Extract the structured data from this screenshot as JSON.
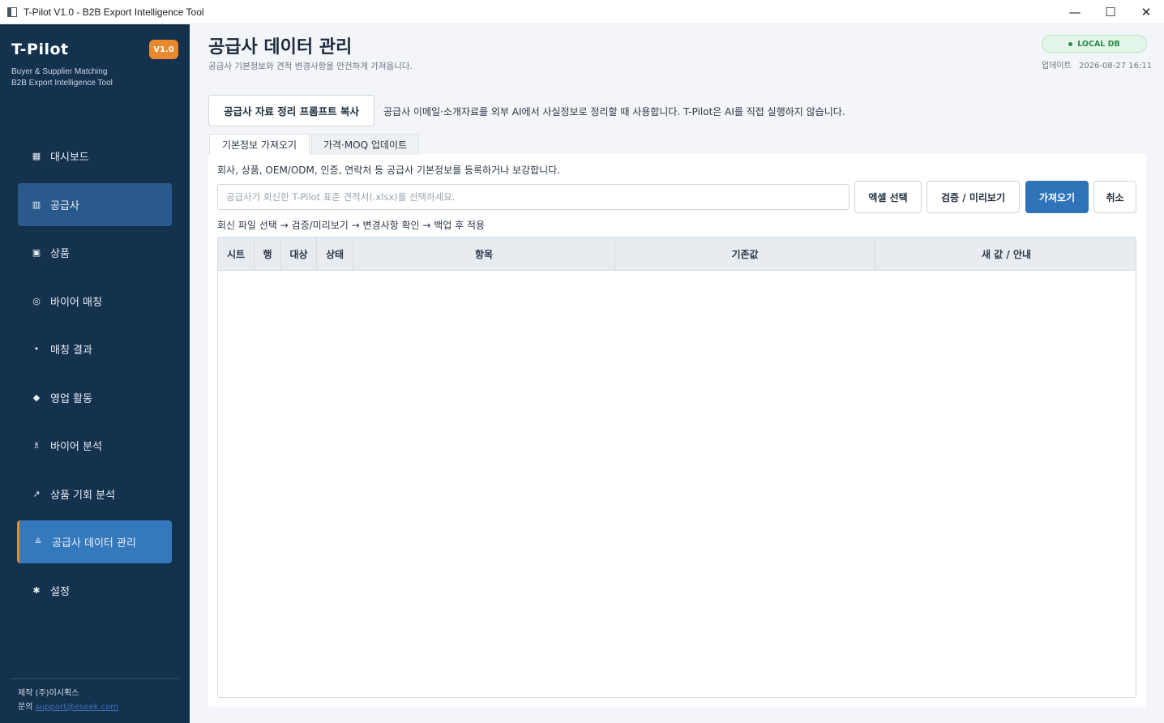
{
  "window": {
    "title": "T-Pilot V1.0 - B2B Export Intelligence Tool",
    "minimize": "—",
    "maximize": "☐",
    "close": "✕"
  },
  "sidebar": {
    "brand": "T-Pilot",
    "version": "V1.0",
    "tagline1": "Buyer & Supplier Matching",
    "tagline2": "B2B Export Intelligence Tool",
    "items": [
      {
        "label": "대시보드",
        "icon": "▦",
        "icon_name": "dashboard-icon"
      },
      {
        "label": "공급사",
        "icon": "▥",
        "icon_name": "supplier-icon"
      },
      {
        "label": "상품",
        "icon": "▣",
        "icon_name": "product-icon"
      },
      {
        "label": "바이어 매칭",
        "icon": "◎",
        "icon_name": "target-icon"
      },
      {
        "label": "매칭 결과",
        "icon": "•",
        "icon_name": "result-icon"
      },
      {
        "label": "영업 활동",
        "icon": "◆",
        "icon_name": "diamond-icon"
      },
      {
        "label": "바이어 분석",
        "icon": "♗",
        "icon_name": "analysis-icon"
      },
      {
        "label": "상품 기회 분석",
        "icon": "↗",
        "icon_name": "trend-icon"
      },
      {
        "label": "공급사 데이터 관리",
        "icon": "≗",
        "icon_name": "data-icon"
      },
      {
        "label": "설정",
        "icon": "✱",
        "icon_name": "gear-icon"
      }
    ],
    "footer_maker": "제작 (주)이시휙스",
    "footer_contact_label": "문의",
    "footer_contact_email": "support@eseek.com"
  },
  "header": {
    "title": "공급사 데이터 관리",
    "subtitle": "공급사 기본정보와 견적 변경사항을 안전하게 가져옵니다.",
    "db_badge": "LOCAL DB",
    "updated_label": "업데이트",
    "updated_value": "2026-08-27 16:11"
  },
  "prompt": {
    "button_label": "공급사 자료 정리 프롬프트 복사",
    "description": "공급사 이메일·소개자료를 외부 AI에서 사실정보로 정리할 때 사용합니다. T-Pilot은 AI를 직접 실행하지 않습니다."
  },
  "tabs": [
    {
      "label": "기본정보 가져오기"
    },
    {
      "label": "가격·MOQ 업데이트"
    }
  ],
  "import": {
    "description": "회사, 상품, OEM/ODM, 인증, 연락처 등 공급사 기본정보를 등록하거나 보강합니다.",
    "file_placeholder": "공급사가 회신한 T-Pilot 표준 견적서(.xlsx)를 선택하세요.",
    "select_excel": "엑셀 선택",
    "validate": "검증 / 미리보기",
    "import": "가져오기",
    "cancel": "취소",
    "flow": "회신 파일 선택 → 검증/미리보기 → 변경사항 확인 → 백업 후 적용"
  },
  "table": {
    "columns": [
      "시트",
      "행",
      "대상",
      "상태",
      "항목",
      "기존값",
      "새 값 / 안내"
    ],
    "rows": []
  }
}
